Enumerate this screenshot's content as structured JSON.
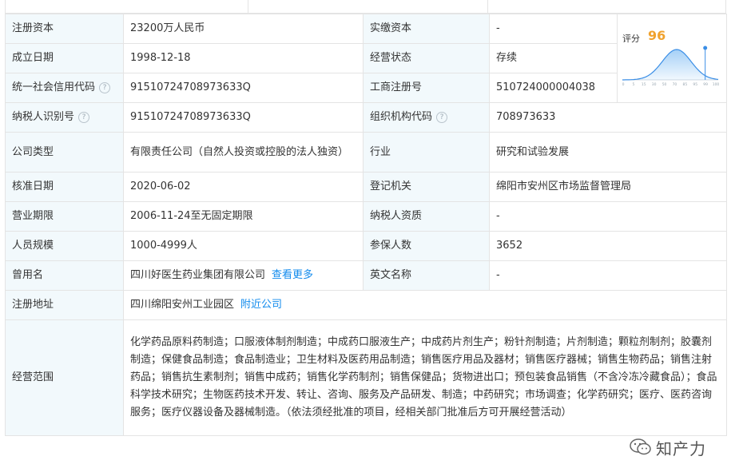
{
  "rows": [
    {
      "l1": "注册资本",
      "v1": "23200万人民币",
      "l2": "实缴资本",
      "v2": "-"
    },
    {
      "l1": "成立日期",
      "v1": "1998-12-18",
      "l2": "经营状态",
      "v2": "存续"
    },
    {
      "l1": "统一社会信用代码",
      "v1": "91510724708973633Q",
      "l2": "工商注册号",
      "v2": "510724000004038"
    },
    {
      "l1": "纳税人识别号",
      "v1": "91510724708973633Q",
      "l2": "组织机构代码",
      "v2": "708973633"
    },
    {
      "l1": "公司类型",
      "v1": "有限责任公司（自然人投资或控股的法人独资）",
      "l2": "行业",
      "v2": "研究和试验发展"
    },
    {
      "l1": "核准日期",
      "v1": "2020-06-02",
      "l2": "登记机关",
      "v2": "绵阳市安州区市场监督管理局"
    },
    {
      "l1": "营业期限",
      "v1": "2006-11-24至无固定期限",
      "l2": "纳税人资质",
      "v2": "-"
    },
    {
      "l1": "人员规模",
      "v1": "1000-4999人",
      "l2": "参保人数",
      "v2": "3652"
    },
    {
      "l1": "曾用名",
      "v1": "四川好医生药业集团有限公司",
      "link": "查看更多",
      "l2": "英文名称",
      "v2": "-"
    },
    {
      "l1": "注册地址",
      "v1": "四川绵阳安州工业园区",
      "link": "附近公司"
    },
    {
      "l1": "经营范围",
      "v1": "化学药品原料药制造；口服液体制剂制造；中成药口服液生产；中成药片剂生产；粉针剂制造；片剂制造；颗粒剂制剂；胶囊剂制造；保健食品制造；食品制造业；卫生材料及医药用品制造；销售医疗用品及器材；销售医疗器械；销售生物药品；销售注射药品；销售抗生素制剂；销售中成药；销售化学药制剂；销售保健品；货物进出口；预包装食品销售（不含冷冻冷藏食品）；食品科学技术研究；生物医药技术开发、转让、咨询、服务及产品研发、制造；中药研究；市场调查；化学药研究；医疗、医药咨询服务；医疗仪器设备及器械制造。（依法须经批准的项目，经相关部门批准后方可开展经营活动）"
    }
  ],
  "score": {
    "label": "评分",
    "value": "96",
    "percentile": 96,
    "axis": [
      "0",
      "5",
      "15",
      "30",
      "50",
      "70",
      "85",
      "95",
      "99",
      "100"
    ]
  },
  "help_icon": "question-circle-icon",
  "accent_color": "#128bed",
  "score_color": "#f0a22e",
  "watermark": {
    "text": "知产力",
    "icon": "wechat-icon"
  }
}
